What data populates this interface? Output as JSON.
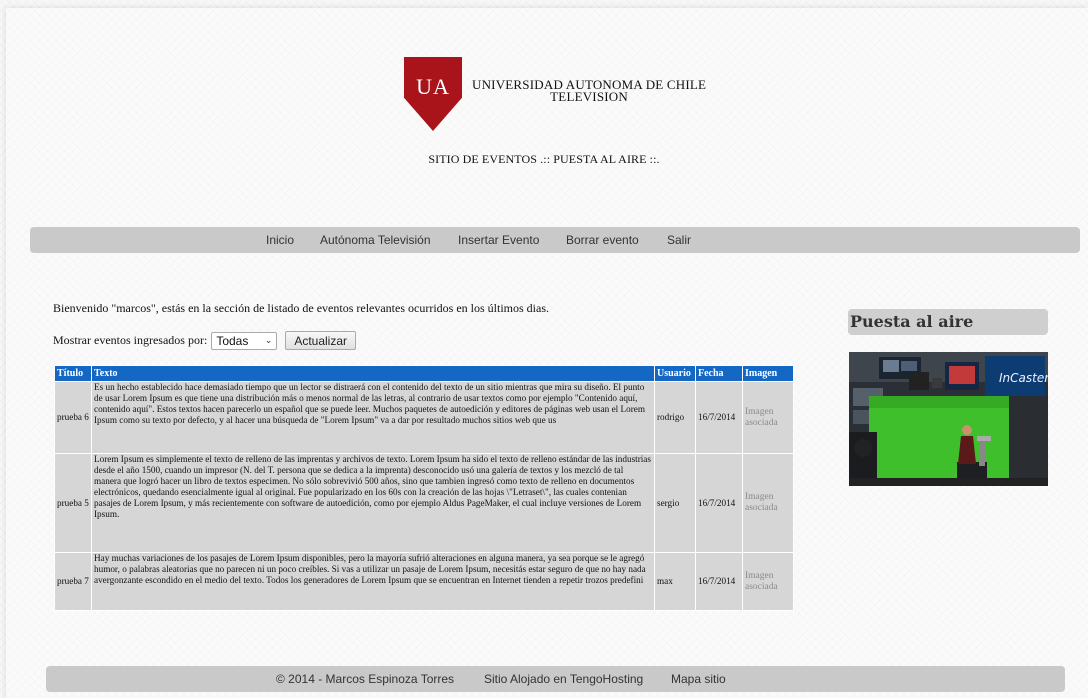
{
  "header": {
    "logo_text": "UA",
    "university_line1": "UNIVERSIDAD AUTONOMA DE CHILE",
    "university_line2": "TELEVISION",
    "site_title": "SITIO DE EVENTOS .:: PUESTA AL AIRE ::."
  },
  "nav": {
    "items": [
      {
        "label": "Inicio"
      },
      {
        "label": "Autónoma Televisión"
      },
      {
        "label": "Insertar Evento"
      },
      {
        "label": "Borrar evento"
      },
      {
        "label": "Salir"
      }
    ]
  },
  "main": {
    "welcome": "Bienvenido \"marcos\", estás en la sección de listado de eventos relevantes ocurridos en los últimos dias.",
    "filter_label": "Mostrar eventos ingresados por:",
    "filter_value": "Todas",
    "update_button": "Actualizar"
  },
  "table": {
    "headers": [
      "Título",
      "Texto",
      "Usuario",
      "Fecha",
      "Imagen"
    ],
    "rows": [
      {
        "titulo": "prueba 6",
        "texto": "Es un hecho establecido hace demasiado tiempo que un lector se distraerá con el contenido del texto de un sitio mientras que mira su diseño. El punto de usar Lorem Ipsum es que tiene una distribución más o menos normal de las letras, al contrario de usar textos como por ejemplo \"Contenido aquí, contenido aquí\". Estos textos hacen parecerlo un español que se puede leer. Muchos paquetes de autoedición y editores de páginas web usan el Lorem Ipsum como su texto por defecto, y al hacer una búsqueda de \"Lorem Ipsum\" va a dar por resultado muchos sitios web que us",
        "usuario": "rodrigo",
        "fecha": "16/7/2014",
        "imagen": "Imagen asociada"
      },
      {
        "titulo": "prueba 5",
        "texto": "Lorem Ipsum es simplemente el texto de relleno de las imprentas y archivos de texto. Lorem Ipsum ha sido el texto de relleno estándar de las industrias desde el año 1500, cuando un impresor (N. del T. persona que se dedica a la imprenta) desconocido usó una galería de textos y los mezcló de tal manera que logró hacer un libro de textos especimen. No sólo sobrevivió 500 años, sino que tambien ingresó como texto de relleno en documentos electrónicos, quedando esencialmente igual al original. Fue popularizado en los 60s con la creación de las hojas \\\"Letraset\\\", las cuales contenian pasajes de Lorem Ipsum, y más recientemente con software de autoedición, como por ejemplo Aldus PageMaker, el cual incluye versiones de Lorem Ipsum.",
        "usuario": "sergio",
        "fecha": "16/7/2014",
        "imagen": "Imagen asociada"
      },
      {
        "titulo": "prueba 7",
        "texto": "Hay muchas variaciones de los pasajes de Lorem Ipsum disponibles, pero la mayoría sufrió alteraciones en alguna manera, ya sea porque se le agregó humor, o palabras aleatorias que no parecen ni un poco creíbles. Si vas a utilizar un pasaje de Lorem Ipsum, necesitás estar seguro de que no hay nada avergonzante escondido en el medio del texto. Todos los generadores de Lorem Ipsum que se encuentran en Internet tienden a repetir trozos predefini",
        "usuario": "max",
        "fecha": "16/7/2014",
        "imagen": "Imagen asociada"
      }
    ]
  },
  "sidebar": {
    "title": "Puesta al aire",
    "image_caption": "InCaster"
  },
  "footer": {
    "copyright": "© 2014 - Marcos Espinoza Torres",
    "hosting": "Sitio Alojado en TengoHosting",
    "sitemap": "Mapa sitio"
  }
}
